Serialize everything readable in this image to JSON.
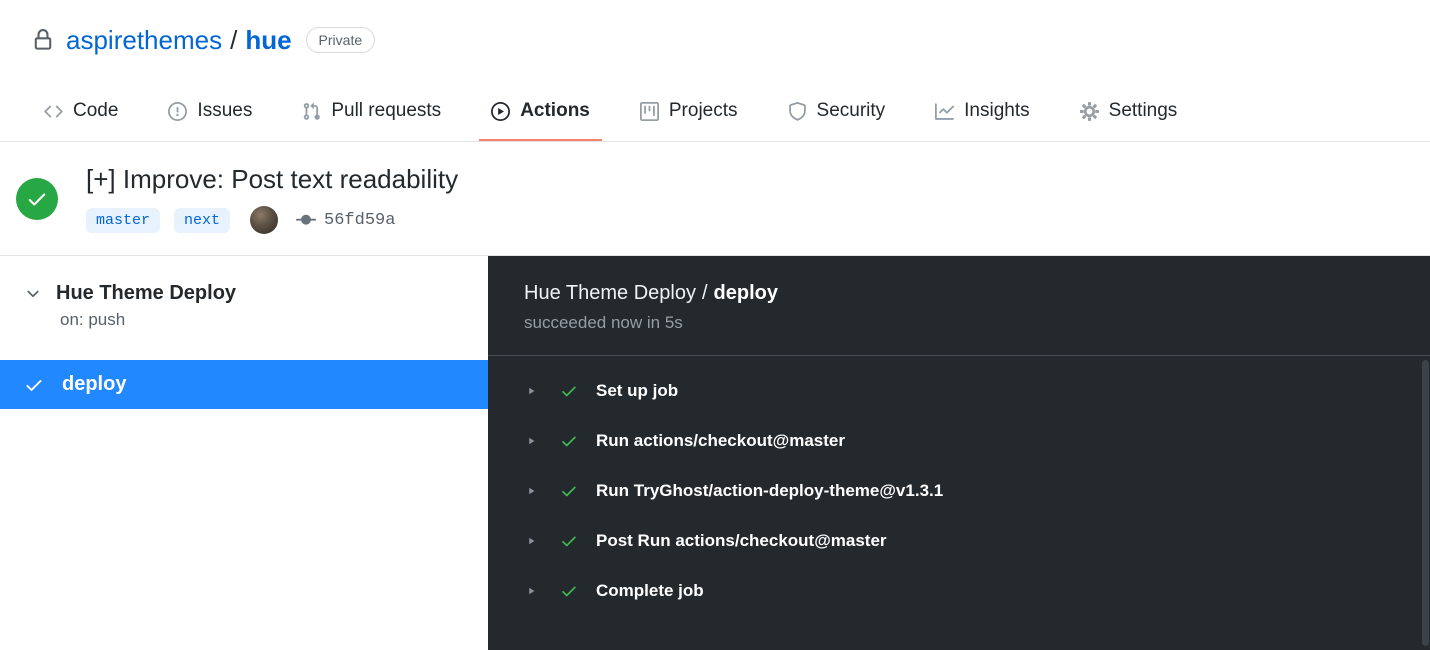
{
  "colors": {
    "link_blue": "#0366d6",
    "success_green": "#28a745",
    "step_check_green": "#3fb950",
    "selected_job_blue": "#2188ff",
    "tab_accent_orange": "#f9826c",
    "dark_panel": "#24292e"
  },
  "breadcrumb": {
    "owner": "aspirethemes",
    "separator": "/",
    "repo": "hue",
    "visibility": "Private"
  },
  "nav": {
    "tabs": [
      {
        "label": "Code",
        "icon": "code-icon",
        "selected": false
      },
      {
        "label": "Issues",
        "icon": "issue-opened-icon",
        "selected": false
      },
      {
        "label": "Pull requests",
        "icon": "git-pull-request-icon",
        "selected": false
      },
      {
        "label": "Actions",
        "icon": "play-icon",
        "selected": true
      },
      {
        "label": "Projects",
        "icon": "project-icon",
        "selected": false
      },
      {
        "label": "Security",
        "icon": "shield-icon",
        "selected": false
      },
      {
        "label": "Insights",
        "icon": "graph-icon",
        "selected": false
      },
      {
        "label": "Settings",
        "icon": "gear-icon",
        "selected": false
      }
    ]
  },
  "run": {
    "status": "success",
    "title": "[+] Improve: Post text readability",
    "branches": [
      "master",
      "next"
    ],
    "commit_sha": "56fd59a"
  },
  "sidebar": {
    "workflow_name": "Hue Theme Deploy",
    "trigger": "on: push",
    "jobs": [
      {
        "name": "deploy",
        "status": "success",
        "selected": true
      }
    ]
  },
  "log": {
    "workflow_name": "Hue Theme Deploy",
    "separator": "/",
    "job_name": "deploy",
    "status_line": "succeeded now in 5s",
    "steps": [
      {
        "name": "Set up job",
        "status": "success"
      },
      {
        "name": "Run actions/checkout@master",
        "status": "success"
      },
      {
        "name": "Run TryGhost/action-deploy-theme@v1.3.1",
        "status": "success"
      },
      {
        "name": "Post Run actions/checkout@master",
        "status": "success"
      },
      {
        "name": "Complete job",
        "status": "success"
      }
    ]
  }
}
